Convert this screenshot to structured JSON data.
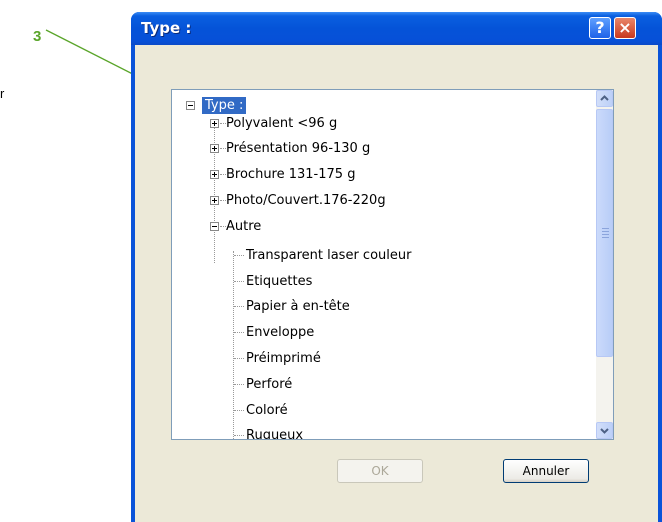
{
  "callout": {
    "number": "3",
    "edge_fragment": "r"
  },
  "dialog": {
    "title": "Type :",
    "help_glyph": "?",
    "close_glyph": "×",
    "tree": {
      "root": "Type :",
      "items": [
        {
          "label": "Polyvalent <96 g",
          "expanded": false
        },
        {
          "label": "Présentation 96-130 g",
          "expanded": false
        },
        {
          "label": "Brochure 131-175 g",
          "expanded": false
        },
        {
          "label": "Photo/Couvert.176-220g",
          "expanded": false
        },
        {
          "label": "Autre",
          "expanded": true,
          "children": [
            "Transparent laser couleur",
            "Etiquettes",
            "Papier à en-tête",
            "Enveloppe",
            "Préimprimé",
            "Perforé",
            "Coloré",
            "Rugueux"
          ]
        }
      ]
    },
    "buttons": {
      "ok": "OK",
      "cancel": "Annuler"
    }
  },
  "colors": {
    "callout": "#5aa52a",
    "titlebar": "#0553d8",
    "selection": "#316ac5"
  }
}
